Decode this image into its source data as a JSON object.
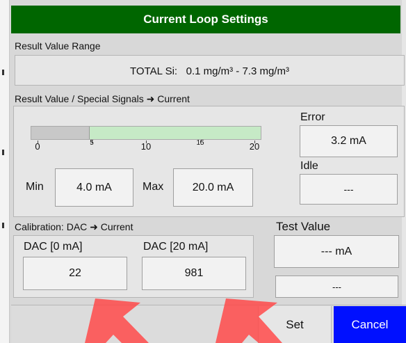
{
  "title": "Current Loop Settings",
  "result_range": {
    "label": "Result Value Range",
    "value": "TOTAL Si:   0.1 mg/m³ - 7.3 mg/m³"
  },
  "mapping": {
    "label": "Result Value / Special Signals ➜ Current",
    "scale": {
      "fill_fraction": 0.25,
      "ticks_major": [
        "0",
        "10",
        "20"
      ],
      "ticks_minor": [
        "5",
        "15"
      ]
    },
    "min_label": "Min",
    "min_value": "4.0 mA",
    "max_label": "Max",
    "max_value": "20.0 mA",
    "error_label": "Error",
    "error_value": "3.2 mA",
    "idle_label": "Idle",
    "idle_value": "---"
  },
  "calibration": {
    "label": "Calibration: DAC ➜ Current",
    "dac0_label": "DAC [0 mA]",
    "dac0_value": "22",
    "dac20_label": "DAC [20 mA]",
    "dac20_value": "981"
  },
  "test": {
    "label": "Test Value",
    "value": "--- mA",
    "secondary": "---"
  },
  "buttons": {
    "set": "Set",
    "cancel": "Cancel"
  },
  "colors": {
    "title_bar": "#006600",
    "cancel_button": "#0010ff",
    "arrows": "#ff4040"
  }
}
